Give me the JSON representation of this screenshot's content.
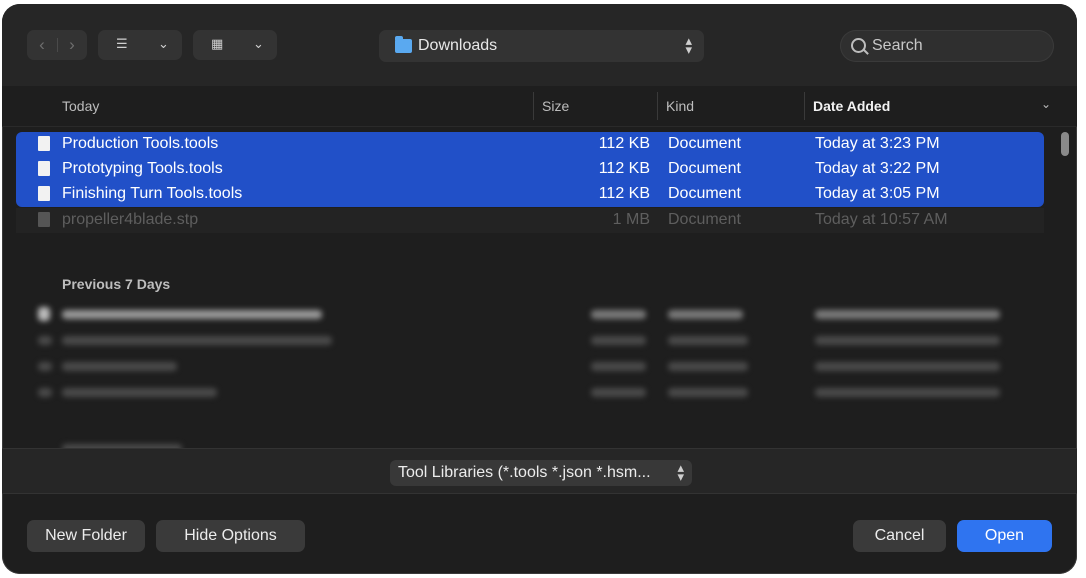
{
  "toolbar": {
    "nav_back": "‹",
    "nav_forward": "›",
    "list_view_icon": "☰",
    "grid_view_icon": "▦",
    "chevron": "⌄",
    "location": "Downloads",
    "search_placeholder": "Search"
  },
  "columns": {
    "name": "Today",
    "size": "Size",
    "kind": "Kind",
    "date": "Date Added"
  },
  "today_files": [
    {
      "name": "Production Tools.tools",
      "size": "112 KB",
      "kind": "Document",
      "date": "Today at 3:23 PM"
    },
    {
      "name": "Prototyping Tools.tools",
      "size": "112 KB",
      "kind": "Document",
      "date": "Today at 3:22 PM"
    },
    {
      "name": "Finishing Turn Tools.tools",
      "size": "112 KB",
      "kind": "Document",
      "date": "Today at 3:05 PM"
    },
    {
      "name": "propeller4blade.stp",
      "size": "1 MB",
      "kind": "Document",
      "date": "Today at 10:57 AM"
    }
  ],
  "sections": {
    "previous_7": "Previous 7 Days"
  },
  "filter": {
    "label": "Tool Libraries (*.tools *.json *.hsm..."
  },
  "buttons": {
    "new_folder": "New Folder",
    "hide_options": "Hide Options",
    "cancel": "Cancel",
    "open": "Open"
  },
  "colors": {
    "selection": "#2150c8",
    "primary_button": "#2f74f0",
    "folder": "#5aa9f0"
  }
}
